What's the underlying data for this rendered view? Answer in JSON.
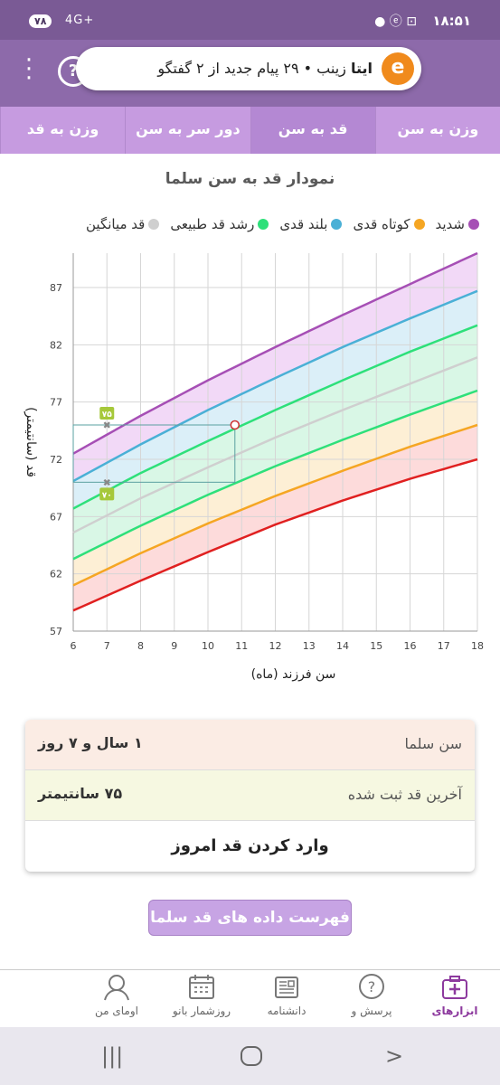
{
  "status_bar": {
    "time": "۱۸:۵۱",
    "battery": "۷۸",
    "signal": "4G+"
  },
  "notification": {
    "app": "ایتا",
    "text": "زینب • ۲۹ پیام جدید از ۲ گفتگو",
    "logo": "e"
  },
  "header": {
    "help_label": "?"
  },
  "tabs": [
    {
      "label": "وزن به سن",
      "active": false
    },
    {
      "label": "قد به سن",
      "active": true
    },
    {
      "label": "دور سر به سن",
      "active": false
    },
    {
      "label": "وزن به قد",
      "active": false
    }
  ],
  "chart_title": "نمودار قد به سن سلما",
  "legend": [
    {
      "label": "شدید",
      "color": "#a64fb5"
    },
    {
      "label": "کوتاه قدی",
      "color": "#f5a623"
    },
    {
      "label": "بلند قدی",
      "color": "#4ab0d6"
    },
    {
      "label": "رشد قد طبیعی",
      "color": "#2ee07a"
    },
    {
      "label": "قد میانگین",
      "color": "#cfcfcf"
    }
  ],
  "chart_data": {
    "type": "line",
    "xlabel": "سن فرزند (ماه)",
    "ylabel": "قد (سانتیمتر)",
    "xlim": [
      6,
      18
    ],
    "ylim": [
      57,
      90
    ],
    "xticks": [
      6,
      7,
      8,
      9,
      10,
      11,
      12,
      13,
      14,
      15,
      16,
      17,
      18
    ],
    "yticks": [
      57,
      62,
      67,
      72,
      77,
      82,
      87
    ],
    "grid": true,
    "x": [
      6,
      8,
      10,
      12,
      14,
      16,
      18
    ],
    "series": [
      {
        "color": "#a64fb5",
        "values": [
          72.5,
          75.8,
          78.9,
          81.8,
          84.6,
          87.3,
          90.0
        ]
      },
      {
        "color": "#4ab0d6",
        "values": [
          70.1,
          73.3,
          76.3,
          79.1,
          81.8,
          84.3,
          86.7
        ]
      },
      {
        "color": "#2ee07a",
        "values": [
          67.7,
          70.8,
          73.6,
          76.3,
          78.9,
          81.4,
          83.7
        ]
      },
      {
        "color": "#cfcfcf",
        "values": [
          65.6,
          68.6,
          71.3,
          73.9,
          76.3,
          78.6,
          80.9
        ]
      },
      {
        "color": "#2ee07a",
        "values": [
          63.3,
          66.2,
          68.9,
          71.4,
          73.7,
          75.9,
          78.0
        ]
      },
      {
        "color": "#f5a623",
        "values": [
          61.0,
          63.8,
          66.4,
          68.8,
          71.0,
          73.1,
          75.0
        ]
      },
      {
        "color": "#e02020",
        "values": [
          58.8,
          61.4,
          63.9,
          66.3,
          68.4,
          70.3,
          72.0
        ]
      }
    ],
    "points": [
      {
        "x": 10.8,
        "y": 75
      }
    ],
    "markers": [
      {
        "x": 7,
        "y": 75,
        "label": "۷۵"
      },
      {
        "x": 7,
        "y": 70,
        "label": "۷۰"
      }
    ]
  },
  "info": {
    "age_label": "سن سلما",
    "age_value": "۱ سال و ۷ روز",
    "last_label": "آخرین قد ثبت شده",
    "last_value": "۷۵ سانتیمتر",
    "action": "وارد کردن قد امروز"
  },
  "list_button": "فهرست داده های قد سلما",
  "bottom_nav": [
    {
      "label": "ابزارهای",
      "icon": "medical-kit-icon",
      "active": true
    },
    {
      "label": "پرسش و",
      "icon": "question-icon",
      "active": false
    },
    {
      "label": "دانشنامه",
      "icon": "encyclopedia-icon",
      "active": false
    },
    {
      "label": "روزشمار بانو",
      "icon": "calendar-icon",
      "active": false
    },
    {
      "label": "اومای من",
      "icon": "profile-icon",
      "active": false
    }
  ]
}
